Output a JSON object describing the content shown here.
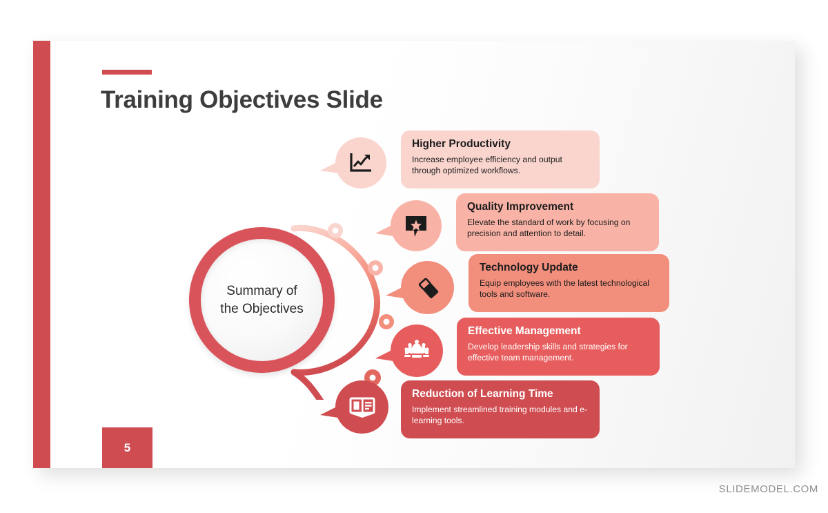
{
  "slide": {
    "title": "Training Objectives Slide",
    "page_number": "5",
    "center_label_line1": "Summary of",
    "center_label_line2": "the Objectives",
    "footer": "SLIDEMODEL.COM"
  },
  "colors": {
    "accent_red": "#cf4c51",
    "ring_red": "#d9545a",
    "tone_1": "#fad5ce",
    "tone_2": "#f9b3a6",
    "tone_3": "#f28e7c",
    "tone_4": "#e75d5d",
    "tone_5": "#cf4c51",
    "text_dark": "#1c1c1c",
    "text_light": "#ffffff",
    "title_gray": "#3d3d3d",
    "footer_gray": "#8d8d8d"
  },
  "objectives": [
    {
      "title": "Higher Productivity",
      "desc": "Increase employee efficiency and output through optimized workflows.",
      "icon": "line-chart-growth-icon",
      "bubble_color": "#fad5ce",
      "box_color": "#fad5ce",
      "text_color": "#1c1c1c",
      "icon_color": "#1c1c1c"
    },
    {
      "title": "Quality Improvement",
      "desc": "Elevate the standard of work by focusing on precision and attention to detail.",
      "icon": "speech-bubble-star-icon",
      "bubble_color": "#f9b3a6",
      "box_color": "#f9b3a6",
      "text_color": "#1c1c1c",
      "icon_color": "#1c1c1c"
    },
    {
      "title": "Technology Update",
      "desc": "Equip employees with the latest technological tools and software.",
      "icon": "usb-flash-drive-icon",
      "bubble_color": "#f28e7c",
      "box_color": "#f28e7c",
      "text_color": "#1c1c1c",
      "icon_color": "#1c1c1c"
    },
    {
      "title": "Effective  Management",
      "desc": "Develop leadership skills and strategies for effective team management.",
      "icon": "meeting-table-icon",
      "bubble_color": "#e75d5d",
      "box_color": "#e75d5d",
      "text_color": "#ffffff",
      "icon_color": "#ffffff"
    },
    {
      "title": "Reduction of Learning Time",
      "desc": "Implement streamlined training modules and e-learning tools.",
      "icon": "open-book-icon",
      "bubble_color": "#cf4c51",
      "box_color": "#cf4c51",
      "text_color": "#ffffff",
      "icon_color": "#ffffff"
    }
  ]
}
